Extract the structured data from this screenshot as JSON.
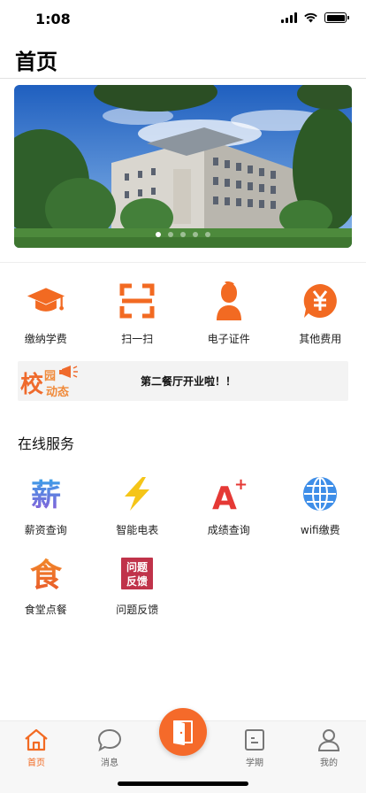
{
  "status_bar": {
    "time": "1:08"
  },
  "header": {
    "title": "首页"
  },
  "banner": {
    "slide_count": 5,
    "active_index": 0
  },
  "quick_actions": [
    {
      "label": "缴纳学费",
      "icon": "graduation-cap-icon"
    },
    {
      "label": "扫一扫",
      "icon": "scan-icon"
    },
    {
      "label": "电子证件",
      "icon": "person-id-icon"
    },
    {
      "label": "其他费用",
      "icon": "yuan-bubble-icon"
    }
  ],
  "news": {
    "logo_text": "校园动态",
    "text": "第二餐厅开业啦！！"
  },
  "online_services": {
    "title": "在线服务",
    "items": [
      {
        "label": "薪资查询",
        "glyph": "薪",
        "icon": "salary-icon"
      },
      {
        "label": "智能电表",
        "icon": "lightning-icon"
      },
      {
        "label": "成绩查询",
        "glyph": "A+",
        "icon": "grade-icon"
      },
      {
        "label": "wifi缴费",
        "icon": "globe-icon"
      },
      {
        "label": "食堂点餐",
        "glyph": "食",
        "icon": "canteen-icon"
      },
      {
        "label": "问题反馈",
        "glyph_lines": [
          "问题",
          "反馈"
        ],
        "icon": "feedback-icon"
      }
    ]
  },
  "tabbar": {
    "items": [
      {
        "label": "首页",
        "icon": "home-icon",
        "active": true
      },
      {
        "label": "消息",
        "icon": "message-icon",
        "active": false
      },
      {
        "label": "学期",
        "icon": "semester-icon",
        "active": false
      },
      {
        "label": "我的",
        "icon": "profile-icon",
        "active": false
      }
    ],
    "center_icon": "door-icon"
  },
  "colors": {
    "accent": "#f26a22",
    "active_tab": "#f26a22",
    "feedback_tile": "#c0334a"
  }
}
